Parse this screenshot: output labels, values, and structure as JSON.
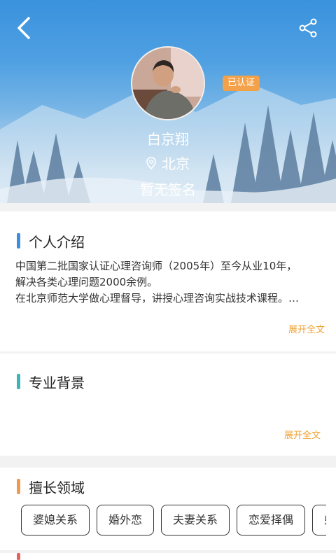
{
  "header": {
    "back_icon": "chevron-left-icon",
    "share_icon": "share-icon",
    "badge": "已认证",
    "name": "白京翔",
    "location_icon": "map-pin-icon",
    "location": "北京",
    "signature": "暂无签名"
  },
  "intro": {
    "title": "个人介绍",
    "accent": "#3c8fe0",
    "lines": [
      "中国第二批国家认证心理咨询师（2005年）至今从业10年，",
      "解决各类心理问题2000余例。",
      "在北京师范大学做心理督导，讲授心理咨询实战技术课程。…"
    ],
    "expand": "展开全文"
  },
  "background": {
    "title": "专业背景",
    "accent": "#3cb5b8",
    "expand": "展开全文"
  },
  "expertise": {
    "title": "擅长领域",
    "accent": "#f09a50",
    "tags": [
      "婆媳关系",
      "婚外恋",
      "夫妻关系",
      "恋爱择偶",
      "婚"
    ]
  }
}
